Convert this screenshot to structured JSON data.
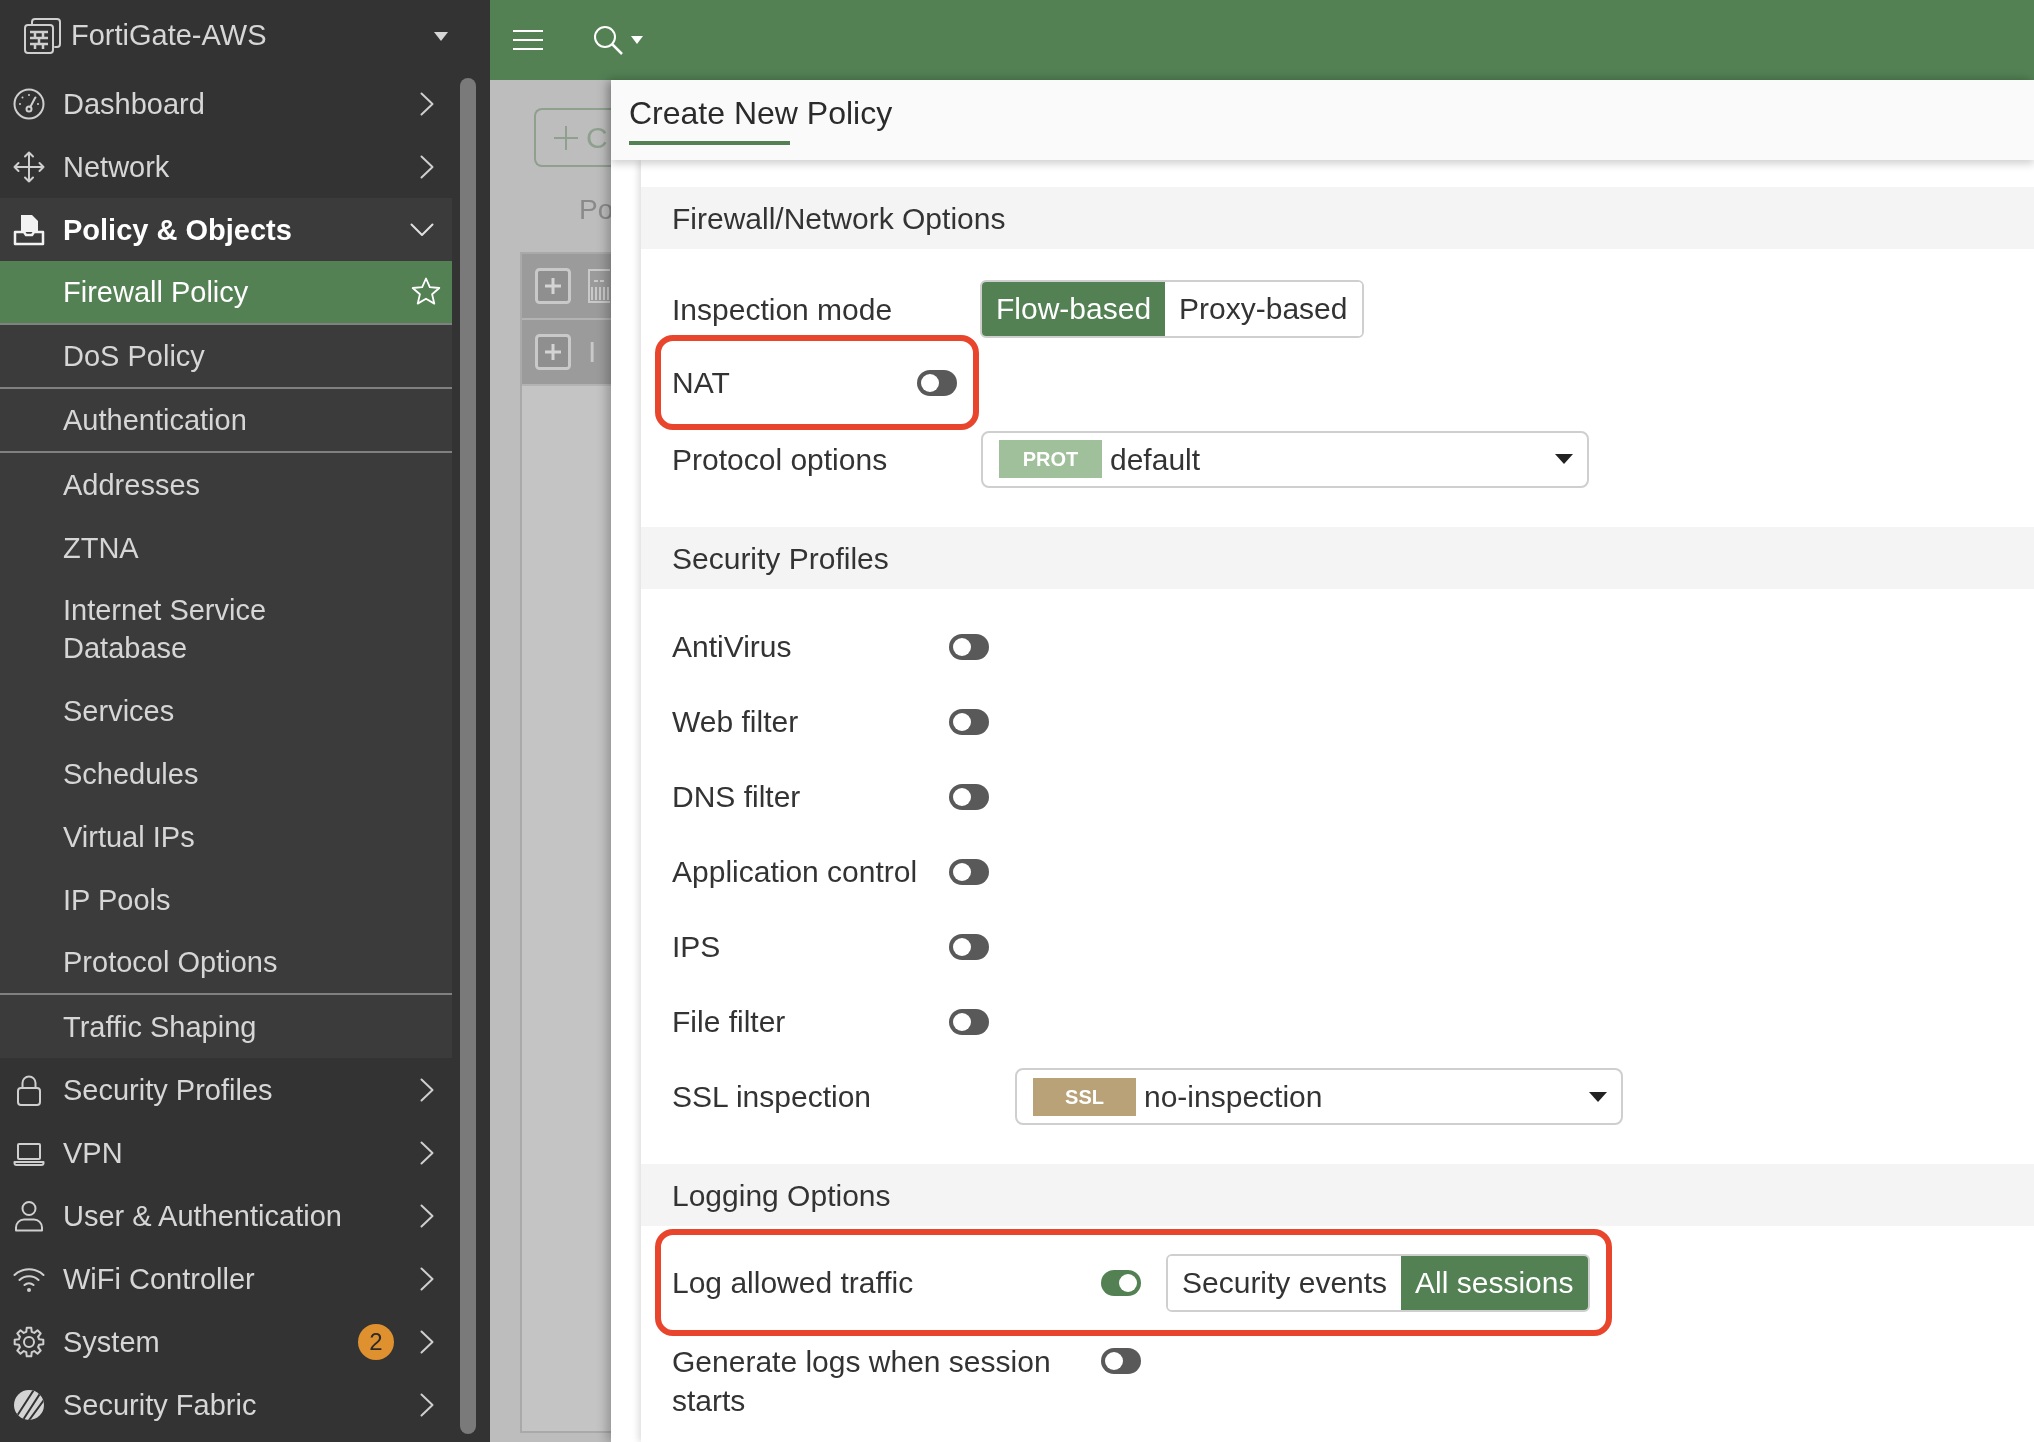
{
  "sidebar": {
    "device_name": "FortiGate-AWS",
    "items": [
      {
        "label": "Dashboard",
        "expanded": false
      },
      {
        "label": "Network",
        "expanded": false
      },
      {
        "label": "Policy & Objects",
        "expanded": true,
        "children": [
          {
            "label": "Firewall Policy",
            "selected": true,
            "divider_after": true
          },
          {
            "label": "DoS Policy",
            "selected": false,
            "divider_after": true
          },
          {
            "label": "Authentication",
            "selected": false,
            "divider_after": true
          },
          {
            "label": "Addresses",
            "selected": false,
            "divider_after": false
          },
          {
            "label": "ZTNA",
            "selected": false,
            "divider_after": false
          },
          {
            "label": "Internet Service Database",
            "selected": false,
            "divider_after": false
          },
          {
            "label": "Services",
            "selected": false,
            "divider_after": false
          },
          {
            "label": "Schedules",
            "selected": false,
            "divider_after": false
          },
          {
            "label": "Virtual IPs",
            "selected": false,
            "divider_after": false
          },
          {
            "label": "IP Pools",
            "selected": false,
            "divider_after": false
          },
          {
            "label": "Protocol Options",
            "selected": false,
            "divider_after": true
          },
          {
            "label": "Traffic Shaping",
            "selected": false,
            "divider_after": false
          }
        ]
      },
      {
        "label": "Security Profiles",
        "expanded": false
      },
      {
        "label": "VPN",
        "expanded": false
      },
      {
        "label": "User & Authentication",
        "expanded": false
      },
      {
        "label": "WiFi Controller",
        "expanded": false
      },
      {
        "label": "System",
        "expanded": false,
        "badge": "2"
      },
      {
        "label": "Security Fabric",
        "expanded": false
      }
    ]
  },
  "background_page": {
    "button_label": "C",
    "heading": "Po",
    "rows": [
      {
        "kind": "icon"
      },
      {
        "kind": "text",
        "text": "I"
      }
    ]
  },
  "dialog": {
    "title": "Create New Policy",
    "sections": [
      {
        "title": "Firewall/Network Options",
        "fields": [
          {
            "kind": "segmented",
            "label": "Inspection mode",
            "highlighted": false,
            "options": [
              {
                "label": "Flow-based",
                "selected": true
              },
              {
                "label": "Proxy-based",
                "selected": false
              }
            ]
          },
          {
            "kind": "toggle",
            "label": "NAT",
            "on": false,
            "highlighted": true
          },
          {
            "kind": "dropdown",
            "label": "Protocol options",
            "tag": "PROT",
            "color": "#9fc09a",
            "value": "default",
            "highlighted": false
          }
        ]
      },
      {
        "title": "Security Profiles",
        "fields": [
          {
            "kind": "toggle",
            "label": "AntiVirus",
            "on": false,
            "highlighted": false
          },
          {
            "kind": "toggle",
            "label": "Web filter",
            "on": false,
            "highlighted": false
          },
          {
            "kind": "toggle",
            "label": "DNS filter",
            "on": false,
            "highlighted": false
          },
          {
            "kind": "toggle",
            "label": "Application control",
            "on": false,
            "highlighted": false
          },
          {
            "kind": "toggle",
            "label": "IPS",
            "on": false,
            "highlighted": false
          },
          {
            "kind": "toggle",
            "label": "File filter",
            "on": false,
            "highlighted": false
          },
          {
            "kind": "dropdown",
            "label": "SSL inspection",
            "tag": "SSL",
            "color": "#b9a178",
            "value": "no-inspection",
            "highlighted": false
          }
        ]
      },
      {
        "title": "Logging Options",
        "fields": [
          {
            "kind": "toggle_segmented",
            "label": "Log allowed traffic",
            "on": true,
            "highlighted": true,
            "options": [
              {
                "label": "Security events",
                "selected": false
              },
              {
                "label": "All sessions",
                "selected": true
              }
            ]
          },
          {
            "kind": "toggle",
            "label": "Generate logs when session starts",
            "on": false,
            "highlighted": false
          }
        ]
      }
    ]
  }
}
